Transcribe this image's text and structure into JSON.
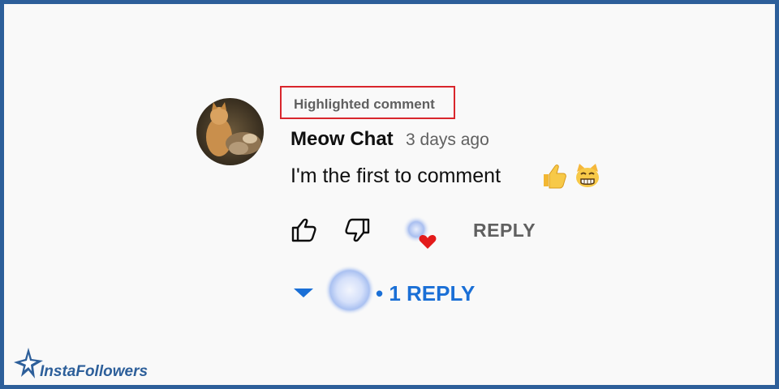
{
  "comment": {
    "badge": "Highlighted comment",
    "author": "Meow Chat",
    "time": "3 days ago",
    "text": "I'm the first to comment",
    "emojis": [
      "thumbs-up-emoji",
      "grinning-cat-emoji"
    ]
  },
  "actions": {
    "reply_label": "REPLY"
  },
  "replies": {
    "label": "• 1 REPLY"
  },
  "branding": {
    "logo_text": "InstaFollowers"
  },
  "colors": {
    "frame": "#2d5f9a",
    "highlight_border": "#d9262c",
    "link_blue": "#1a6fd6",
    "heart_red": "#e31b1b"
  }
}
